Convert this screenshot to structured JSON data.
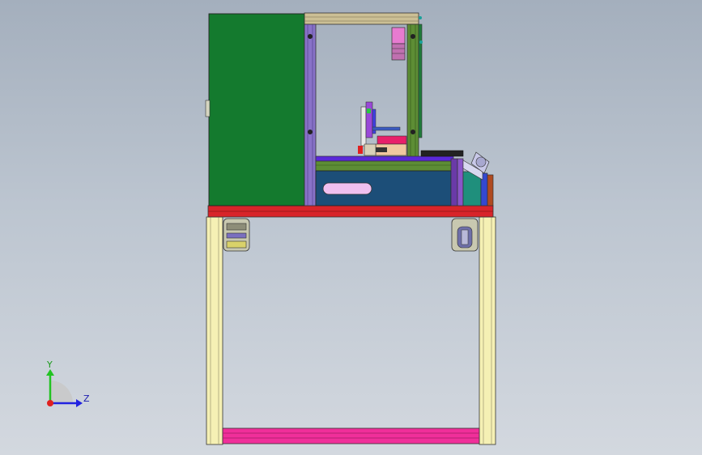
{
  "viewport": {
    "background_top": "#a4afbd",
    "background_bottom": "#d3d8df"
  },
  "triad": {
    "y_label": "Y",
    "z_label": "Z",
    "y_color": "#22c322",
    "z_color": "#2222e0",
    "x_color": "#e02020"
  },
  "model": {
    "cabinet_color": "#147a2e",
    "base_plate_color": "#d8242a",
    "leg_color": "#f5f0b4",
    "bottom_bar_color": "#f02f9a",
    "tray_color": "#1c4e78"
  }
}
